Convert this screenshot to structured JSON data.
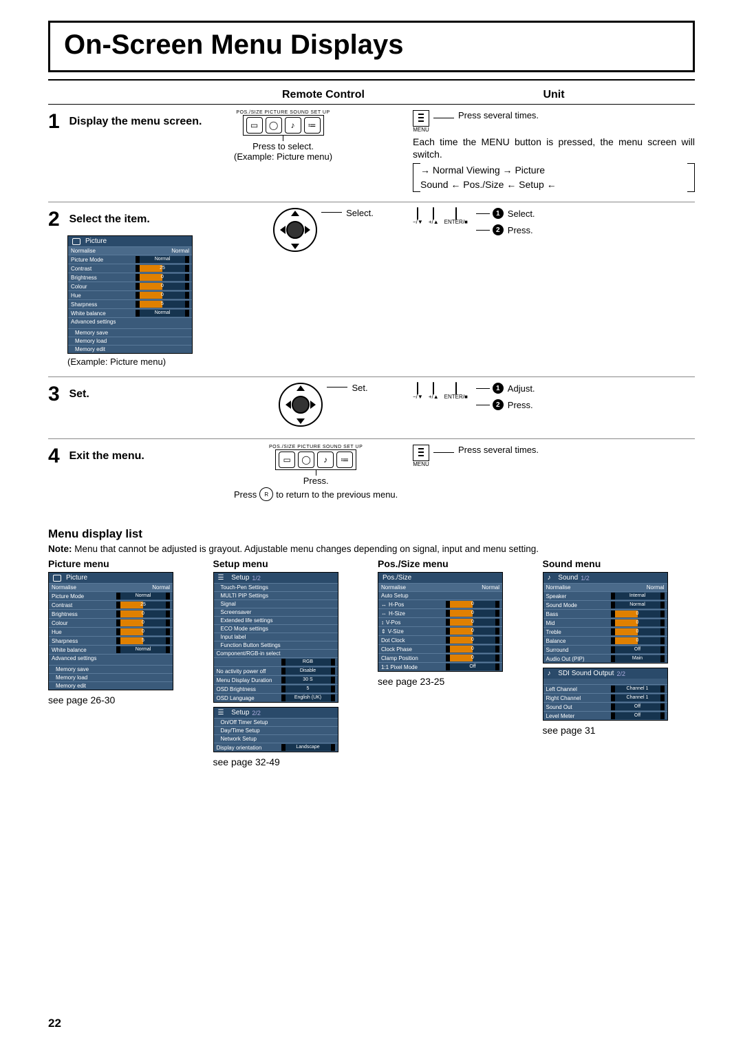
{
  "page_number": "22",
  "title": "On-Screen Menu Displays",
  "columns": {
    "remote": "Remote Control",
    "unit": "Unit"
  },
  "steps": {
    "s1": {
      "num": "1",
      "title": "Display the menu screen.",
      "remote": {
        "labels": "POS./SIZE PICTURE SOUND SET UP",
        "press": "Press to select.",
        "example": "(Example: Picture menu)"
      },
      "unit": {
        "press_several": "Press several times.",
        "menu": "MENU",
        "desc": "Each time the MENU button is pressed, the menu screen will switch.",
        "flow1": "→ Normal Viewing  → Picture",
        "flow2": "Sound ← Pos./Size ← Setup ←"
      }
    },
    "s2": {
      "num": "2",
      "title": "Select the item.",
      "example": "(Example: Picture menu)",
      "remote_label": "Select.",
      "unit_label1": "Select.",
      "unit_label2": "Press.",
      "unit_sub1": "−/▼",
      "unit_sub2": "+/▲",
      "unit_sub3": "ENTER/■"
    },
    "s3": {
      "num": "3",
      "title": "Set.",
      "remote_label": "Set.",
      "unit_label1": "Adjust.",
      "unit_label2": "Press.",
      "unit_sub1": "−/▼",
      "unit_sub2": "+/▲",
      "unit_sub3": "ENTER/■"
    },
    "s4": {
      "num": "4",
      "title": "Exit the menu.",
      "remote": {
        "labels": "POS./SIZE PICTURE SOUND SET UP",
        "press": "Press.",
        "r_label": "R",
        "return": "to return to the previous menu.",
        "press2": "Press"
      },
      "unit": {
        "press_several": "Press several times.",
        "menu": "MENU"
      }
    }
  },
  "picture_osd": {
    "title": "Picture",
    "normalise": "Normalise",
    "normal": "Normal",
    "rows": [
      {
        "lab": "Picture Mode",
        "val": "Normal"
      },
      {
        "lab": "Contrast",
        "val": "25"
      },
      {
        "lab": "Brightness",
        "val": "0"
      },
      {
        "lab": "Colour",
        "val": "0"
      },
      {
        "lab": "Hue",
        "val": "0"
      },
      {
        "lab": "Sharpness",
        "val": "5"
      },
      {
        "lab": "White balance",
        "val": "Normal"
      },
      {
        "lab": "Advanced settings",
        "val": ""
      }
    ],
    "mem": [
      "Memory save",
      "Memory load",
      "Memory edit"
    ]
  },
  "menu_list": {
    "heading": "Menu display list",
    "note_label": "Note:",
    "note": "Menu that cannot be adjusted is grayout. Adjustable menu changes depending on signal, input and menu setting.",
    "picture": {
      "heading": "Picture menu",
      "see": "see page 26-30"
    },
    "setup": {
      "heading": "Setup menu",
      "title": "Setup",
      "page1": "1/2",
      "page2": "2/2",
      "rows1_top": [
        "Touch-Pen Settings",
        "MULTI PIP Settings",
        "Signal",
        "Screensaver",
        "Extended life settings",
        "ECO Mode settings",
        "Input label",
        "Function Button Settings",
        "Component/RGB-in select"
      ],
      "rows1_bottom": [
        {
          "lab": "",
          "val": "RGB"
        },
        {
          "lab": "No activity power off",
          "val": "Disable"
        },
        {
          "lab": "Menu Display Duration",
          "val": "30 S"
        },
        {
          "lab": "OSD Brightness",
          "val": "5"
        },
        {
          "lab": "OSD Language",
          "val": "English (UK)"
        }
      ],
      "rows2": [
        "On/Off Timer Setup",
        "Day/Time Setup",
        "Network Setup"
      ],
      "rows2_last": {
        "lab": "Display orientation",
        "val": "Landscape"
      },
      "see": "see page 32-49"
    },
    "possize": {
      "heading": "Pos./Size menu",
      "title": "Pos./Size",
      "normalise": "Normalise",
      "normal": "Normal",
      "autosetup": "Auto Setup",
      "rows": [
        {
          "lab": "H-Pos",
          "val": "0"
        },
        {
          "lab": "H-Size",
          "val": "0"
        },
        {
          "lab": "V-Pos",
          "val": "0"
        },
        {
          "lab": "V-Size",
          "val": "0"
        },
        {
          "lab": "Dot Clock",
          "val": "0"
        },
        {
          "lab": "Clock Phase",
          "val": "0"
        },
        {
          "lab": "Clamp Position",
          "val": "0"
        },
        {
          "lab": "1:1 Pixel Mode",
          "val": "Off"
        }
      ],
      "see": "see page 23-25"
    },
    "sound": {
      "heading": "Sound menu",
      "title": "Sound",
      "page1": "1/2",
      "normalise": "Normalise",
      "normal": "Normal",
      "rows": [
        {
          "lab": "Speaker",
          "val": "Internal"
        },
        {
          "lab": "Sound Mode",
          "val": "Normal"
        },
        {
          "lab": "Bass",
          "val": "0"
        },
        {
          "lab": "Mid",
          "val": "0"
        },
        {
          "lab": "Treble",
          "val": "0"
        },
        {
          "lab": "Balance",
          "val": "0"
        },
        {
          "lab": "Surround",
          "val": "Off"
        },
        {
          "lab": "Audio Out (PIP)",
          "val": "Main"
        }
      ],
      "sdi_title": "SDI Sound Output",
      "page2": "2/2",
      "sdi_rows": [
        {
          "lab": "Left Channel",
          "val": "Channel 1"
        },
        {
          "lab": "Right Channel",
          "val": "Channel 1"
        },
        {
          "lab": "Sound Out",
          "val": "Off"
        },
        {
          "lab": "Level Meter",
          "val": "Off"
        }
      ],
      "see": "see page 31"
    }
  }
}
